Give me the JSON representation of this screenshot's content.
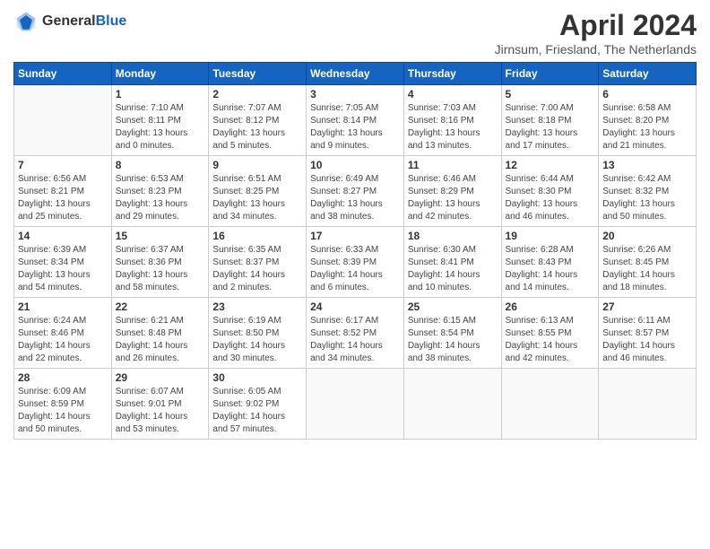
{
  "header": {
    "logo_general": "General",
    "logo_blue": "Blue",
    "month_year": "April 2024",
    "location": "Jirnsum, Friesland, The Netherlands"
  },
  "weekdays": [
    "Sunday",
    "Monday",
    "Tuesday",
    "Wednesday",
    "Thursday",
    "Friday",
    "Saturday"
  ],
  "weeks": [
    [
      {
        "day": "",
        "sunrise": "",
        "sunset": "",
        "daylight": ""
      },
      {
        "day": "1",
        "sunrise": "Sunrise: 7:10 AM",
        "sunset": "Sunset: 8:11 PM",
        "daylight": "Daylight: 13 hours and 0 minutes."
      },
      {
        "day": "2",
        "sunrise": "Sunrise: 7:07 AM",
        "sunset": "Sunset: 8:12 PM",
        "daylight": "Daylight: 13 hours and 5 minutes."
      },
      {
        "day": "3",
        "sunrise": "Sunrise: 7:05 AM",
        "sunset": "Sunset: 8:14 PM",
        "daylight": "Daylight: 13 hours and 9 minutes."
      },
      {
        "day": "4",
        "sunrise": "Sunrise: 7:03 AM",
        "sunset": "Sunset: 8:16 PM",
        "daylight": "Daylight: 13 hours and 13 minutes."
      },
      {
        "day": "5",
        "sunrise": "Sunrise: 7:00 AM",
        "sunset": "Sunset: 8:18 PM",
        "daylight": "Daylight: 13 hours and 17 minutes."
      },
      {
        "day": "6",
        "sunrise": "Sunrise: 6:58 AM",
        "sunset": "Sunset: 8:20 PM",
        "daylight": "Daylight: 13 hours and 21 minutes."
      }
    ],
    [
      {
        "day": "7",
        "sunrise": "Sunrise: 6:56 AM",
        "sunset": "Sunset: 8:21 PM",
        "daylight": "Daylight: 13 hours and 25 minutes."
      },
      {
        "day": "8",
        "sunrise": "Sunrise: 6:53 AM",
        "sunset": "Sunset: 8:23 PM",
        "daylight": "Daylight: 13 hours and 29 minutes."
      },
      {
        "day": "9",
        "sunrise": "Sunrise: 6:51 AM",
        "sunset": "Sunset: 8:25 PM",
        "daylight": "Daylight: 13 hours and 34 minutes."
      },
      {
        "day": "10",
        "sunrise": "Sunrise: 6:49 AM",
        "sunset": "Sunset: 8:27 PM",
        "daylight": "Daylight: 13 hours and 38 minutes."
      },
      {
        "day": "11",
        "sunrise": "Sunrise: 6:46 AM",
        "sunset": "Sunset: 8:29 PM",
        "daylight": "Daylight: 13 hours and 42 minutes."
      },
      {
        "day": "12",
        "sunrise": "Sunrise: 6:44 AM",
        "sunset": "Sunset: 8:30 PM",
        "daylight": "Daylight: 13 hours and 46 minutes."
      },
      {
        "day": "13",
        "sunrise": "Sunrise: 6:42 AM",
        "sunset": "Sunset: 8:32 PM",
        "daylight": "Daylight: 13 hours and 50 minutes."
      }
    ],
    [
      {
        "day": "14",
        "sunrise": "Sunrise: 6:39 AM",
        "sunset": "Sunset: 8:34 PM",
        "daylight": "Daylight: 13 hours and 54 minutes."
      },
      {
        "day": "15",
        "sunrise": "Sunrise: 6:37 AM",
        "sunset": "Sunset: 8:36 PM",
        "daylight": "Daylight: 13 hours and 58 minutes."
      },
      {
        "day": "16",
        "sunrise": "Sunrise: 6:35 AM",
        "sunset": "Sunset: 8:37 PM",
        "daylight": "Daylight: 14 hours and 2 minutes."
      },
      {
        "day": "17",
        "sunrise": "Sunrise: 6:33 AM",
        "sunset": "Sunset: 8:39 PM",
        "daylight": "Daylight: 14 hours and 6 minutes."
      },
      {
        "day": "18",
        "sunrise": "Sunrise: 6:30 AM",
        "sunset": "Sunset: 8:41 PM",
        "daylight": "Daylight: 14 hours and 10 minutes."
      },
      {
        "day": "19",
        "sunrise": "Sunrise: 6:28 AM",
        "sunset": "Sunset: 8:43 PM",
        "daylight": "Daylight: 14 hours and 14 minutes."
      },
      {
        "day": "20",
        "sunrise": "Sunrise: 6:26 AM",
        "sunset": "Sunset: 8:45 PM",
        "daylight": "Daylight: 14 hours and 18 minutes."
      }
    ],
    [
      {
        "day": "21",
        "sunrise": "Sunrise: 6:24 AM",
        "sunset": "Sunset: 8:46 PM",
        "daylight": "Daylight: 14 hours and 22 minutes."
      },
      {
        "day": "22",
        "sunrise": "Sunrise: 6:21 AM",
        "sunset": "Sunset: 8:48 PM",
        "daylight": "Daylight: 14 hours and 26 minutes."
      },
      {
        "day": "23",
        "sunrise": "Sunrise: 6:19 AM",
        "sunset": "Sunset: 8:50 PM",
        "daylight": "Daylight: 14 hours and 30 minutes."
      },
      {
        "day": "24",
        "sunrise": "Sunrise: 6:17 AM",
        "sunset": "Sunset: 8:52 PM",
        "daylight": "Daylight: 14 hours and 34 minutes."
      },
      {
        "day": "25",
        "sunrise": "Sunrise: 6:15 AM",
        "sunset": "Sunset: 8:54 PM",
        "daylight": "Daylight: 14 hours and 38 minutes."
      },
      {
        "day": "26",
        "sunrise": "Sunrise: 6:13 AM",
        "sunset": "Sunset: 8:55 PM",
        "daylight": "Daylight: 14 hours and 42 minutes."
      },
      {
        "day": "27",
        "sunrise": "Sunrise: 6:11 AM",
        "sunset": "Sunset: 8:57 PM",
        "daylight": "Daylight: 14 hours and 46 minutes."
      }
    ],
    [
      {
        "day": "28",
        "sunrise": "Sunrise: 6:09 AM",
        "sunset": "Sunset: 8:59 PM",
        "daylight": "Daylight: 14 hours and 50 minutes."
      },
      {
        "day": "29",
        "sunrise": "Sunrise: 6:07 AM",
        "sunset": "Sunset: 9:01 PM",
        "daylight": "Daylight: 14 hours and 53 minutes."
      },
      {
        "day": "30",
        "sunrise": "Sunrise: 6:05 AM",
        "sunset": "Sunset: 9:02 PM",
        "daylight": "Daylight: 14 hours and 57 minutes."
      },
      {
        "day": "",
        "sunrise": "",
        "sunset": "",
        "daylight": ""
      },
      {
        "day": "",
        "sunrise": "",
        "sunset": "",
        "daylight": ""
      },
      {
        "day": "",
        "sunrise": "",
        "sunset": "",
        "daylight": ""
      },
      {
        "day": "",
        "sunrise": "",
        "sunset": "",
        "daylight": ""
      }
    ]
  ]
}
